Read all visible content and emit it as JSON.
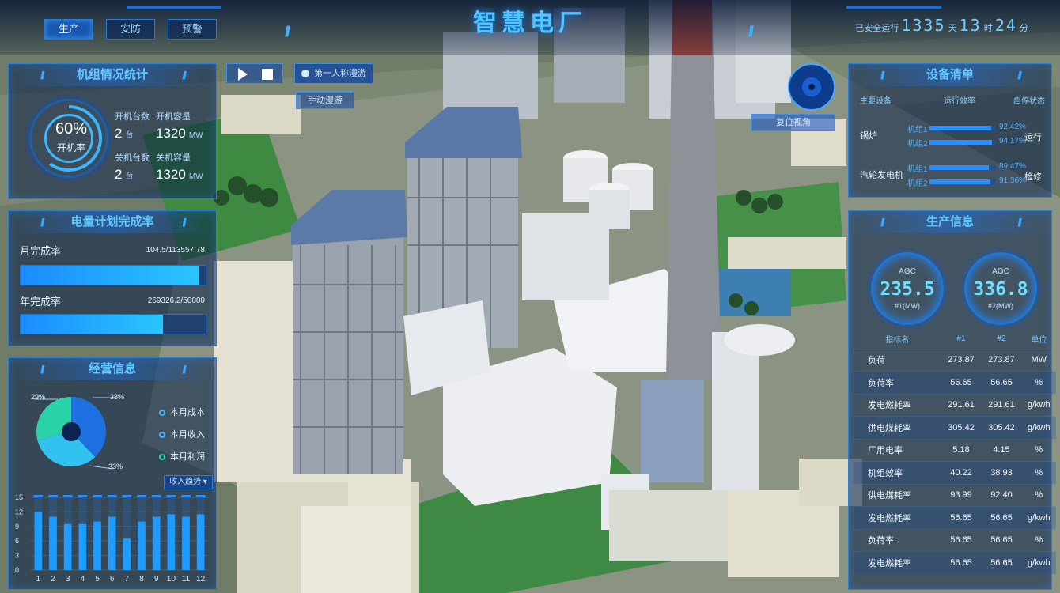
{
  "header": {
    "title": "智慧电厂",
    "nav": [
      {
        "label": "生产",
        "active": true
      },
      {
        "label": "安防",
        "active": false
      },
      {
        "label": "预警",
        "active": false
      }
    ],
    "safe_label": "已安全运行",
    "safe_years": "1335",
    "year_unit": "天",
    "safe_hours": "13",
    "hour_unit": "时",
    "safe_minutes": "24",
    "minute_unit": "分"
  },
  "scene_controls": {
    "play_icon": "play-icon",
    "stop_icon": "stop-icon",
    "person_icon": "person-icon",
    "first_person_label": "第一人称漫游",
    "manual_label": "手动漫游",
    "reset_label": "复位视角",
    "compass_icon": "compass-icon"
  },
  "units": {
    "title": "机组情况统计",
    "rate_value": "60%",
    "rate_label": "开机率",
    "rate_fraction": 0.6,
    "on_count_label": "开机台数",
    "on_count": "2",
    "count_unit": "台",
    "on_capacity_label": "开机容量",
    "on_capacity": "1320",
    "capacity_unit": "MW",
    "off_count_label": "关机台数",
    "off_count": "2",
    "off_capacity_label": "关机容量",
    "off_capacity": "1320"
  },
  "plan": {
    "title": "电量计划完成率",
    "month_label": "月完成率",
    "month_value": "104.5/113557.78",
    "month_fraction": 0.96,
    "year_label": "年完成率",
    "year_value": "269326.2/50000",
    "year_fraction": 0.77
  },
  "business": {
    "title": "经营信息",
    "legend": [
      "本月成本",
      "本月收入",
      "本月利润"
    ],
    "pie_labels": [
      "29%",
      "38%",
      "33%"
    ],
    "trend_select": "收入趋势",
    "colors": {
      "cost": "#1e6fe0",
      "income": "#32c2f0",
      "profit": "#2bd3a8"
    }
  },
  "chart_data": {
    "type": "bar",
    "categories": [
      "1",
      "2",
      "3",
      "4",
      "5",
      "6",
      "7",
      "8",
      "9",
      "10",
      "11",
      "12"
    ],
    "values": [
      12,
      11,
      9.5,
      9.5,
      10,
      11,
      6.5,
      10,
      11,
      11.5,
      11,
      11.5
    ],
    "ylim": [
      0,
      15
    ],
    "yticks": [
      "15",
      "12",
      "9",
      "6",
      "3",
      "0"
    ]
  },
  "equipment": {
    "title": "设备清单",
    "headers": [
      "主要设备",
      "运行效率",
      "启停状态"
    ],
    "items": [
      {
        "name": "锅炉",
        "status": "运行",
        "subs": [
          {
            "label": "机组1",
            "pct": "92.42%",
            "fraction": 0.9242
          },
          {
            "label": "机组2",
            "pct": "94.17%",
            "fraction": 0.9417
          }
        ]
      },
      {
        "name": "汽轮发电机",
        "status": "检修",
        "subs": [
          {
            "label": "机组1",
            "pct": "89.47%",
            "fraction": 0.8947
          },
          {
            "label": "机组2",
            "pct": "91.36%",
            "fraction": 0.9136
          }
        ]
      }
    ]
  },
  "production": {
    "title": "生产信息",
    "gauges": [
      {
        "label": "AGC",
        "value": "235.5",
        "sub": "#1(MW)"
      },
      {
        "label": "AGC",
        "value": "336.8",
        "sub": "#2(MW)"
      }
    ],
    "columns": [
      "指标名",
      "#1",
      "#2",
      "单位"
    ],
    "rows": [
      [
        "负荷",
        "273.87",
        "273.87",
        "MW"
      ],
      [
        "负荷率",
        "56.65",
        "56.65",
        "%"
      ],
      [
        "发电燃耗率",
        "291.61",
        "291.61",
        "g/kwh"
      ],
      [
        "供电煤耗率",
        "305.42",
        "305.42",
        "g/kwh"
      ],
      [
        "厂用电率",
        "5.18",
        "4.15",
        "%"
      ],
      [
        "机组效率",
        "40.22",
        "38.93",
        "%"
      ],
      [
        "供电煤耗率",
        "93.99",
        "92.40",
        "%"
      ],
      [
        "发电燃耗率",
        "56.65",
        "56.65",
        "g/kwh"
      ],
      [
        "负荷率",
        "56.65",
        "56.65",
        "%"
      ],
      [
        "发电燃耗率",
        "56.65",
        "56.65",
        "g/kwh"
      ]
    ]
  }
}
